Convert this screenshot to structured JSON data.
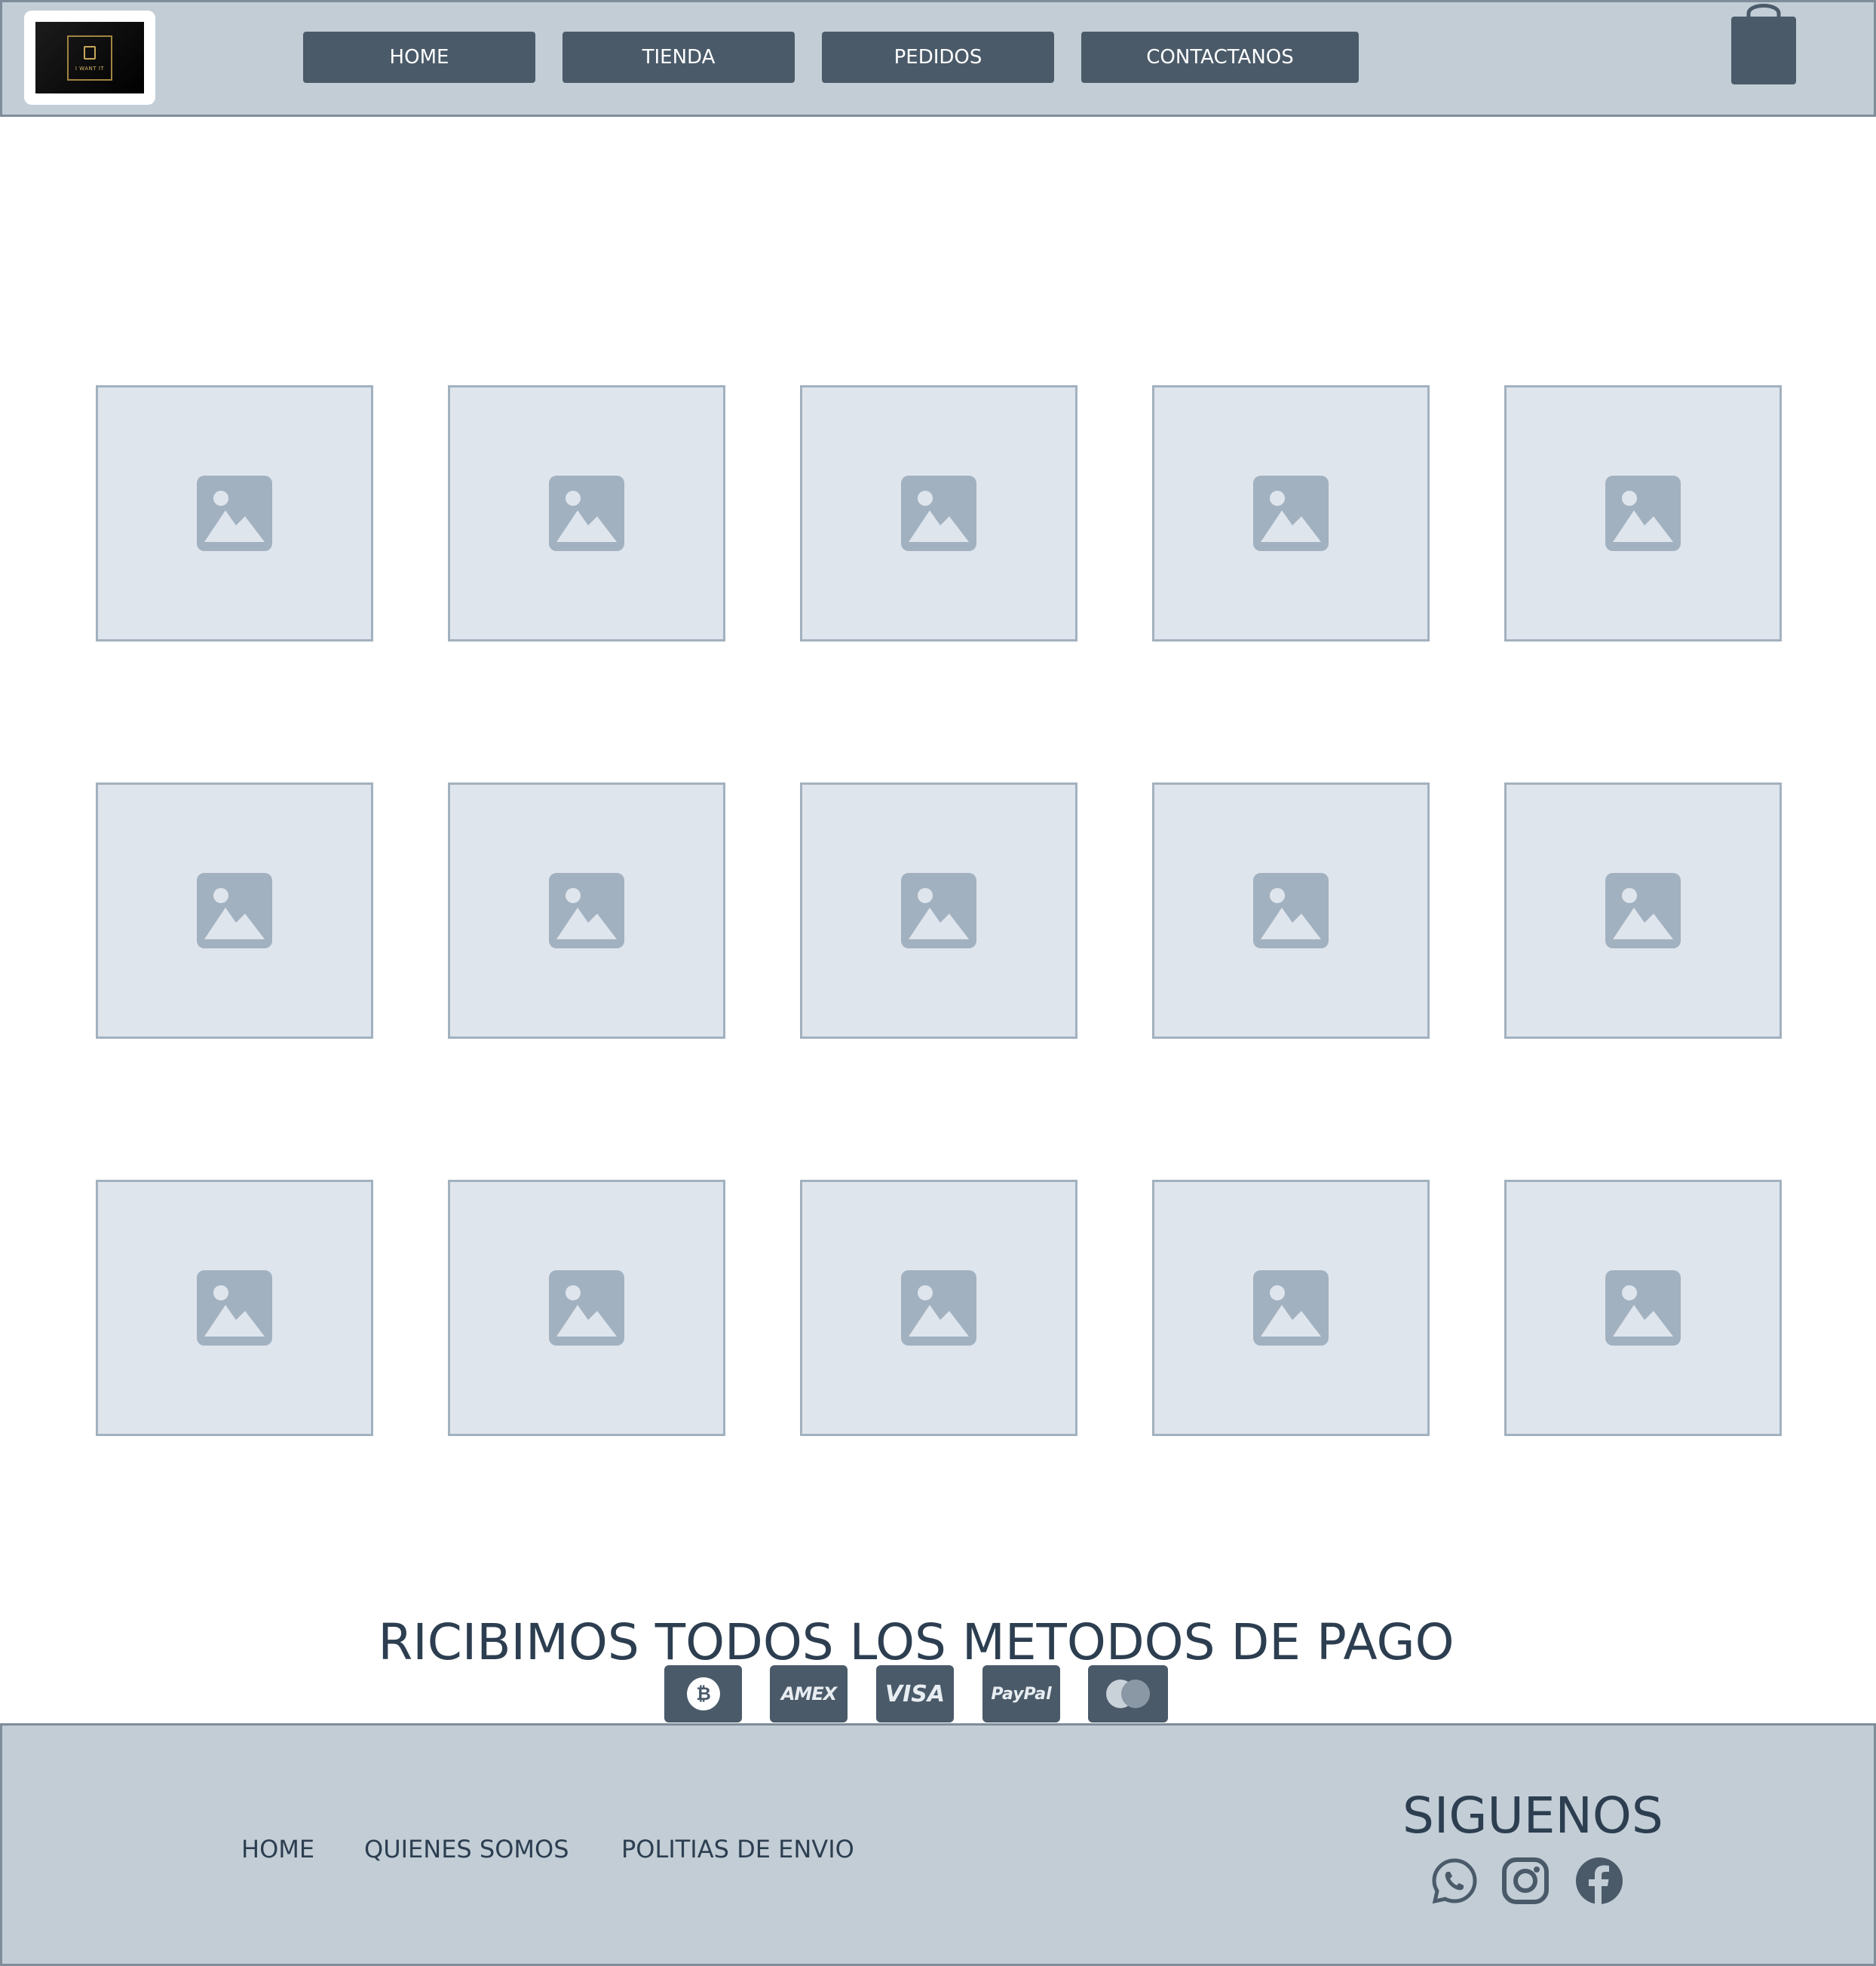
{
  "header": {
    "logo_text": "I WANT IT",
    "nav": [
      {
        "label": "HOME"
      },
      {
        "label": "TIENDA"
      },
      {
        "label": "PEDIDOS"
      },
      {
        "label": "CONTACTANOS"
      }
    ],
    "cart_icon": "shopping-bag-icon"
  },
  "grid": {
    "rows": 3,
    "columns": 5,
    "tile_icon": "image-placeholder-icon"
  },
  "payment": {
    "title": "RICIBIMOS TODOS LOS METODOS DE PAGO",
    "methods": [
      {
        "name": "bitcoin",
        "label": "₿"
      },
      {
        "name": "amex",
        "label": "AMEX"
      },
      {
        "name": "visa",
        "label": "VISA"
      },
      {
        "name": "paypal",
        "label": "PayPal"
      },
      {
        "name": "mastercard",
        "label": ""
      }
    ]
  },
  "footer": {
    "links": [
      {
        "label": "HOME"
      },
      {
        "label": "QUIENES SOMOS"
      },
      {
        "label": "POLITIAS DE ENVIO"
      }
    ],
    "follow_title": "SIGUENOS",
    "social": [
      "whatsapp-icon",
      "instagram-icon",
      "facebook-icon"
    ]
  },
  "colors": {
    "header_bg": "#c2cdd6",
    "button_bg": "#4a5a69",
    "tile_bg": "#dfe5ed",
    "tile_border": "#a2b1bf",
    "text_dark": "#2c3e50"
  }
}
